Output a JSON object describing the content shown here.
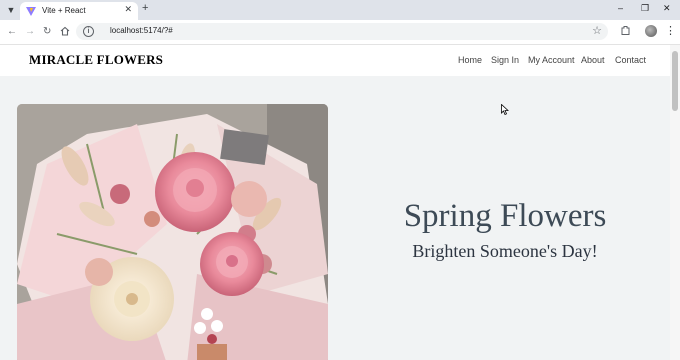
{
  "browser": {
    "tab_title": "Vite + React",
    "url": "localhost:5174/?#",
    "icons": [
      "tab-list-icon",
      "vite-favicon-icon",
      "close-icon",
      "plus-icon",
      "minimize-icon",
      "restore-icon",
      "close-window-icon",
      "back-icon",
      "forward-icon",
      "reload-icon",
      "home-icon",
      "info-icon",
      "star-icon",
      "extensions-icon",
      "profile-avatar",
      "menu-icon"
    ]
  },
  "site": {
    "brand": "MIRACLE FLOWERS",
    "nav": [
      "Home",
      "Sign In",
      "My Account",
      "About",
      "Contact"
    ]
  },
  "hero": {
    "title": "Spring Flowers",
    "subtitle": "Brighten Someone's Day!"
  },
  "colors": {
    "page_bg": "#f1f3f4",
    "header_bg": "#ffffff",
    "title_color": "#3d4a56",
    "subtitle_color": "#2c3440"
  }
}
